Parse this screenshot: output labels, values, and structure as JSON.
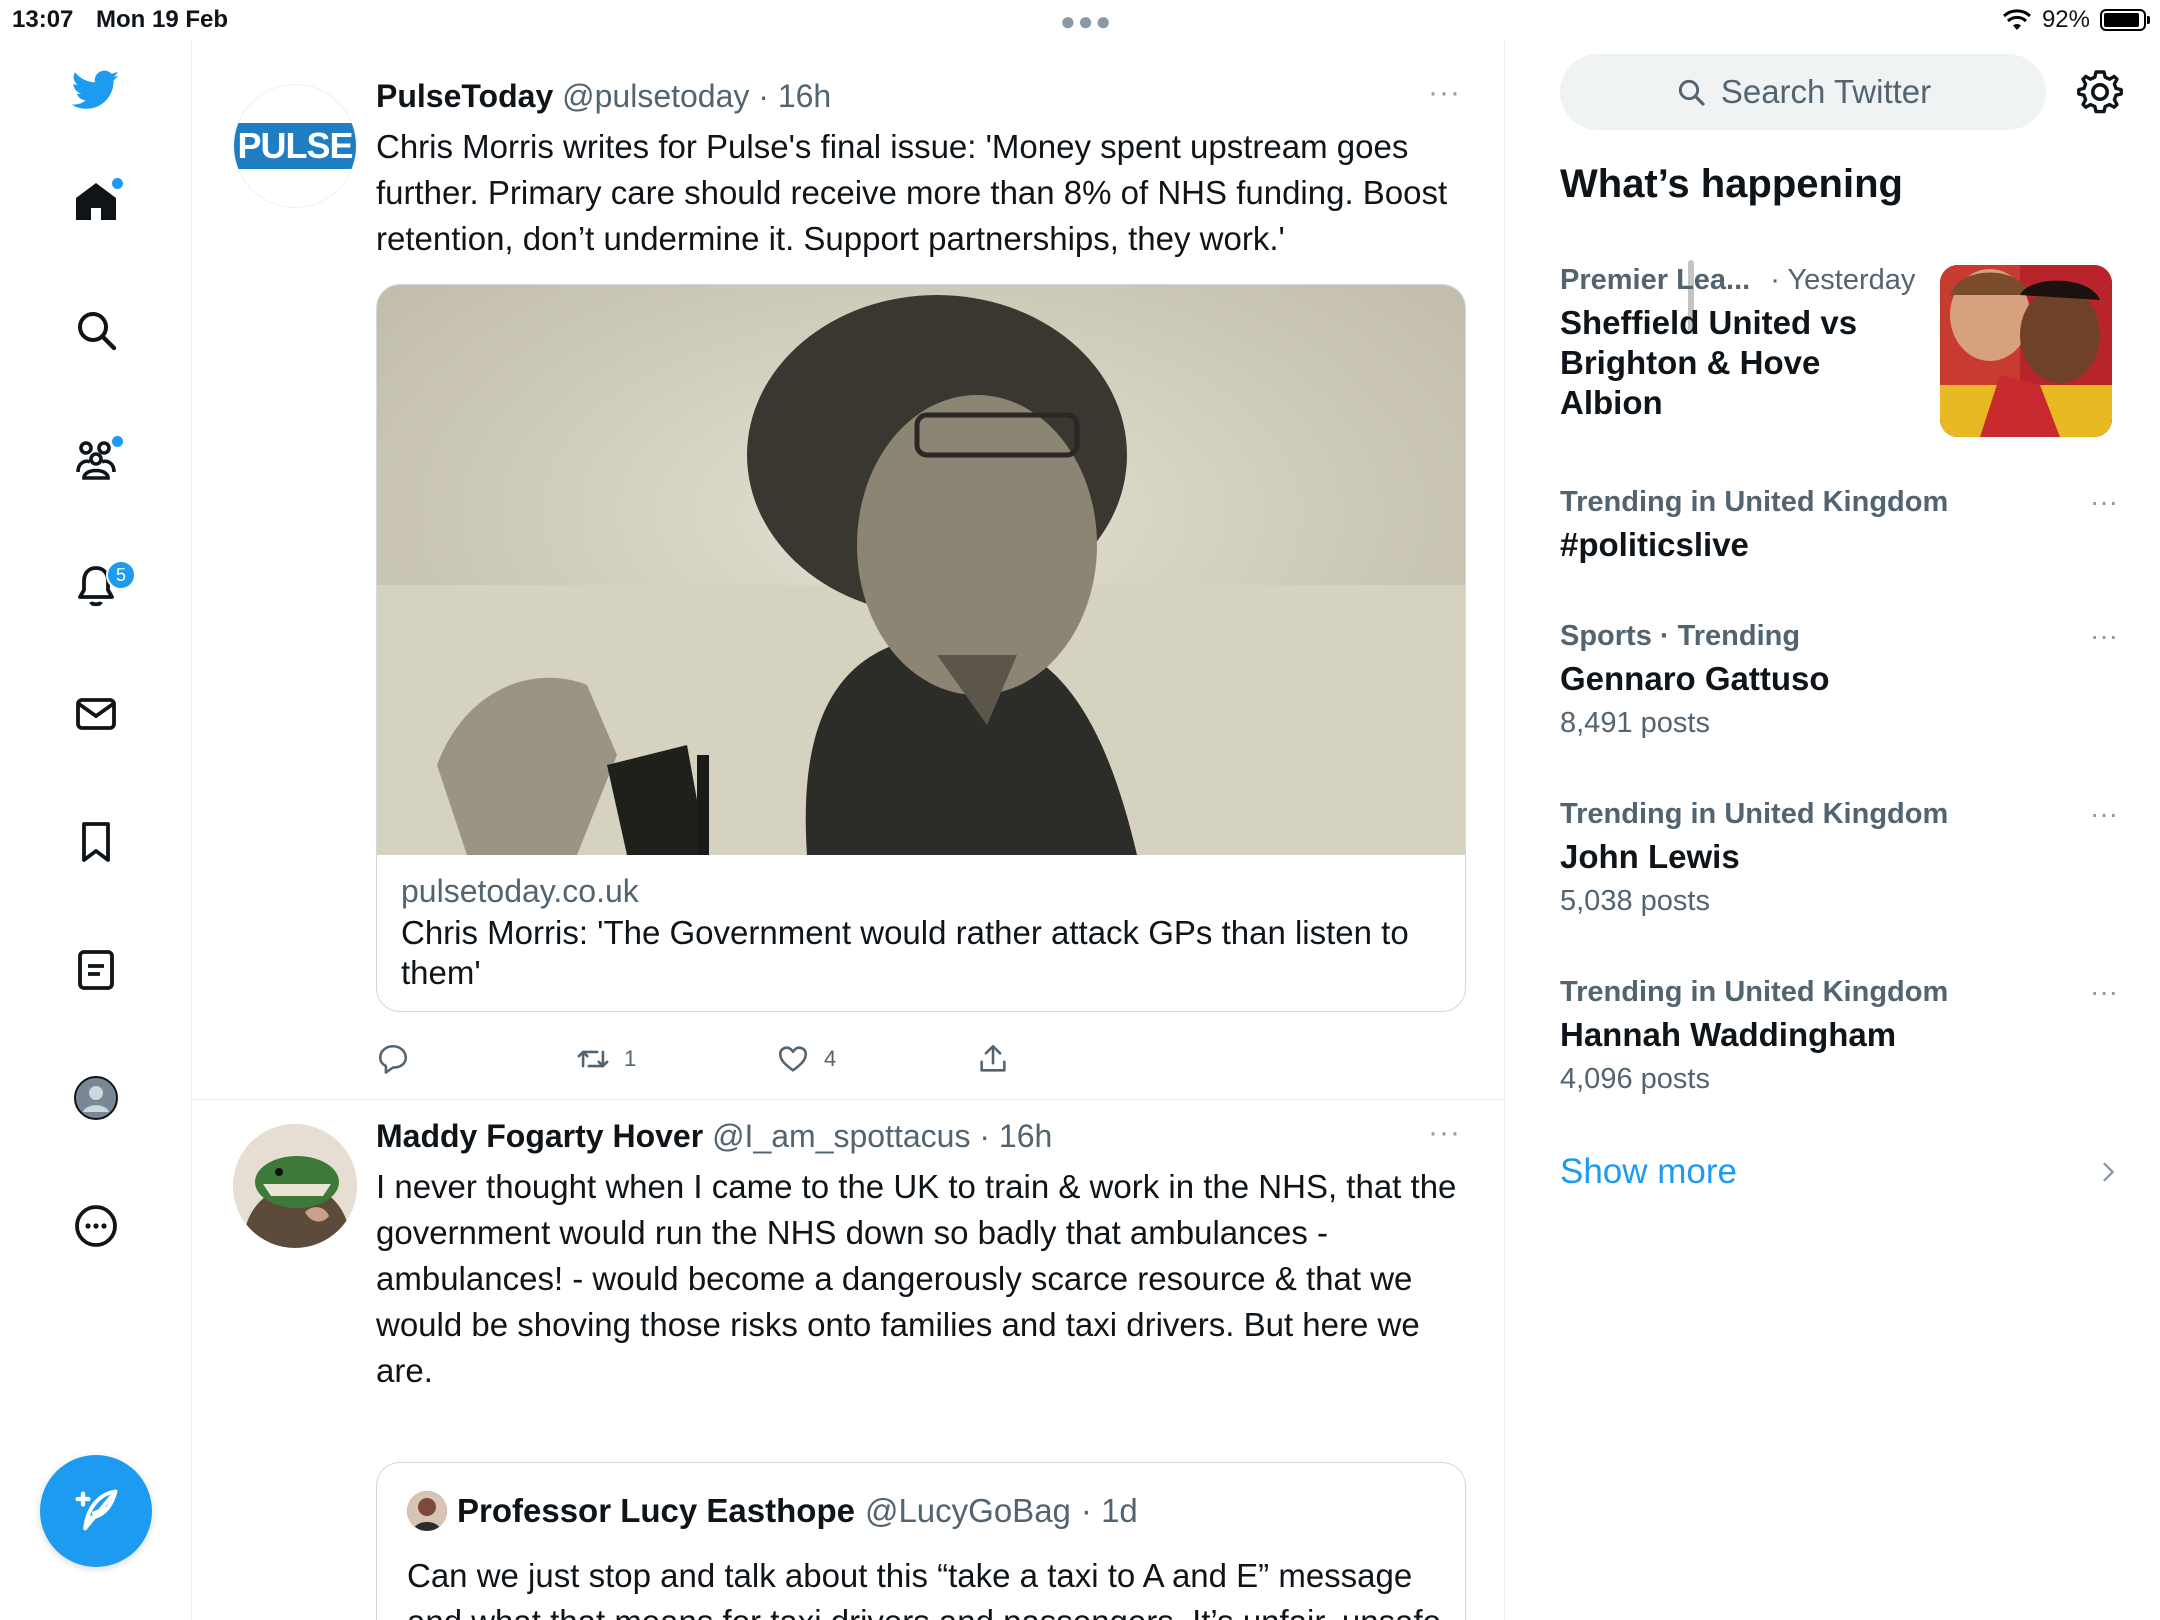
{
  "status": {
    "time": "13:07",
    "date": "Mon 19 Feb",
    "battery": "92%",
    "battery_level": 0.92
  },
  "nav": {
    "notifications_badge": "5"
  },
  "tweets": [
    {
      "name": "PulseToday",
      "handle": "@pulsetoday",
      "time": "· 16h",
      "avatar_text": "PULSE",
      "text": "Chris Morris writes for Pulse's final issue: 'Money spent upstream goes further. Primary care should receive more than 8% of NHS funding. Boost retention, don’t undermine it. Support partnerships, they work.'",
      "card": {
        "domain": "pulsetoday.co.uk",
        "title": "Chris Morris: 'The Government would rather attack GPs than listen to them'"
      },
      "retweets": "1",
      "likes": "4"
    },
    {
      "name": "Maddy Fogarty Hover",
      "handle": "@I_am_spottacus",
      "time": "· 16h",
      "text": "I never thought when I came to the UK to train & work in the NHS, that the government would run the NHS down so badly that ambulances - ambulances! - would become a dangerously scarce resource & that we would be shoving those risks onto families and taxi drivers. But here we are.",
      "quote": {
        "name": "Professor Lucy Easthope",
        "handle": "@LucyGoBag",
        "time": "· 1d",
        "text": "Can we just stop and talk about this “take a taxi to A and E” message and what that means for taxi drivers and passengers. It’s unfair, unsafe and creates all sorts of access and ableist issues. My"
      }
    }
  ],
  "sidebar": {
    "search_placeholder": "Search Twitter",
    "title": "What’s happening",
    "trends": [
      {
        "context": "Premier Lea...",
        "context_time": "· Yesterday",
        "name": "Sheffield United vs Brighton & Hove Albion"
      },
      {
        "context": "Trending in United Kingdom",
        "name": "#politicslive"
      },
      {
        "context": "Sports · Trending",
        "name": "Gennaro Gattuso",
        "count": "8,491 posts"
      },
      {
        "context": "Trending in United Kingdom",
        "name": "John Lewis",
        "count": "5,038 posts"
      },
      {
        "context": "Trending in United Kingdom",
        "name": "Hannah Waddingham",
        "count": "4,096 posts"
      }
    ],
    "show_more": "Show more"
  },
  "colors": {
    "accent": "#1d9bf0",
    "text": "#0f1419",
    "secondary": "#536471",
    "border": "#e6ecf0"
  }
}
